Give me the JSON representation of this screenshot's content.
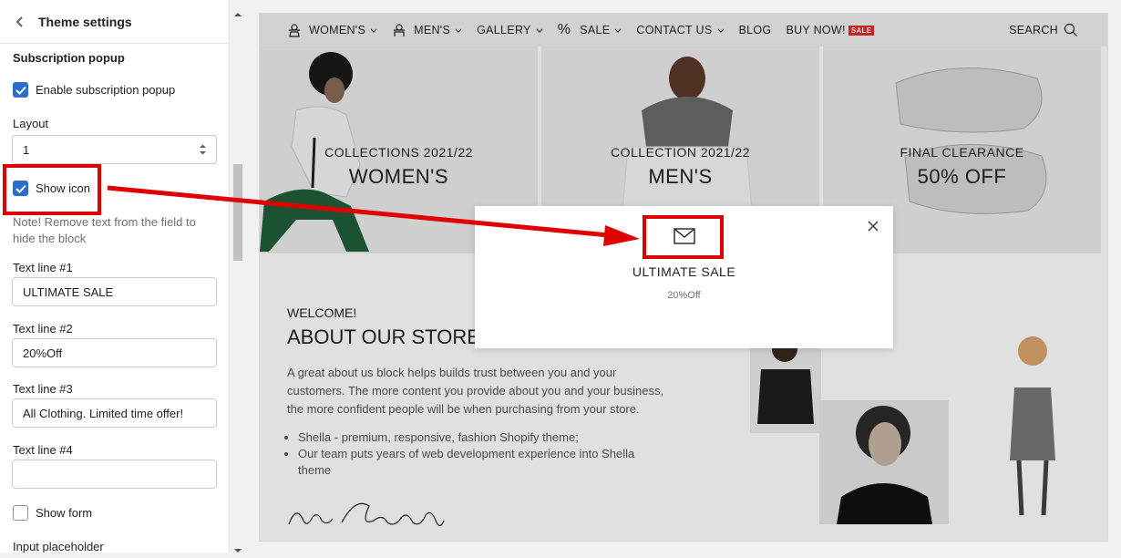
{
  "panel": {
    "title": "Theme settings",
    "section": "Subscription popup",
    "enable_popup": {
      "label": "Enable subscription popup",
      "checked": true
    },
    "layout": {
      "label": "Layout",
      "value": "1"
    },
    "show_icon": {
      "label": "Show icon",
      "checked": true
    },
    "note": "Note! Remove text from the field to hide the block",
    "text_line_1": {
      "label": "Text line #1",
      "value": "ULTIMATE SALE"
    },
    "text_line_2": {
      "label": "Text line #2",
      "value": "20%Off"
    },
    "text_line_3": {
      "label": "Text line #3",
      "value": "All Clothing. Limited time offer!"
    },
    "text_line_4": {
      "label": "Text line #4",
      "value": ""
    },
    "show_form": {
      "label": "Show form",
      "checked": false
    },
    "input_placeholder": {
      "label": "Input placeholder"
    }
  },
  "preview": {
    "nav": {
      "items": [
        {
          "label": "WOMEN'S",
          "icon": "woman-icon",
          "dropdown": true
        },
        {
          "label": "MEN'S",
          "icon": "man-icon",
          "dropdown": true
        },
        {
          "label": "GALLERY",
          "icon": "",
          "dropdown": true
        },
        {
          "label": "SALE",
          "icon": "percent-icon",
          "dropdown": true
        },
        {
          "label": "CONTACT US",
          "icon": "",
          "dropdown": true
        },
        {
          "label": "BLOG",
          "icon": "",
          "dropdown": false
        },
        {
          "label": "BUY NOW!",
          "icon": "",
          "dropdown": false,
          "badge": "SALE"
        }
      ],
      "search": "SEARCH"
    },
    "banners": [
      {
        "subtitle": "COLLECTIONS 2021/22",
        "title": "WOMEN'S"
      },
      {
        "subtitle": "COLLECTION 2021/22",
        "title": "MEN'S"
      },
      {
        "subtitle": "FINAL CLEARANCE",
        "title": "50% OFF"
      }
    ],
    "about": {
      "welcome": "WELCOME!",
      "title": "ABOUT OUR STORE",
      "text": "A great about us block helps builds trust between you and your customers. The more content you provide about you and your business, the more confident people will be when purchasing from your store.",
      "bullets": [
        "Shella - premium, responsive, fashion Shopify theme;",
        "Our team puts years of web development experience into Shella theme"
      ],
      "signature": "Annie Greenberg"
    },
    "popup": {
      "icon": "envelope-icon",
      "line1": "ULTIMATE SALE",
      "line2": "20%Off"
    }
  },
  "colors": {
    "accent": "#2c6ecb",
    "highlight": "#e00000",
    "sale_badge": "#e02a2a"
  }
}
